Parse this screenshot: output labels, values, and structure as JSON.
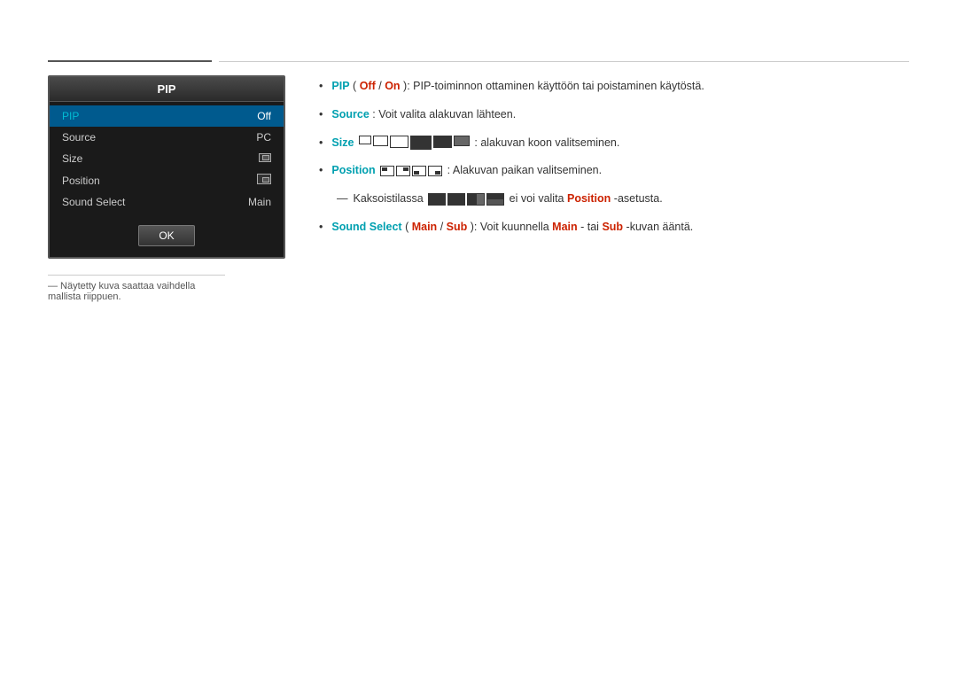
{
  "topLine": {},
  "pipPanel": {
    "title": "PIP",
    "rows": [
      {
        "label": "PIP",
        "value": "Off",
        "selected": true,
        "iconType": "none"
      },
      {
        "label": "Source",
        "value": "PC",
        "selected": false,
        "iconType": "none"
      },
      {
        "label": "Size",
        "value": "",
        "selected": false,
        "iconType": "size"
      },
      {
        "label": "Position",
        "value": "",
        "selected": false,
        "iconType": "position"
      },
      {
        "label": "Sound Select",
        "value": "Main",
        "selected": false,
        "iconType": "none"
      }
    ],
    "okButton": "OK"
  },
  "footnote": "― Näytetty kuva saattaa vaihdella mallista riippuen.",
  "bullets": [
    {
      "id": "pip",
      "parts": [
        {
          "text": "PIP",
          "style": "cyan-bold"
        },
        {
          "text": " (",
          "style": "normal"
        },
        {
          "text": "Off",
          "style": "red-bold"
        },
        {
          "text": " / ",
          "style": "normal"
        },
        {
          "text": "On",
          "style": "red-bold"
        },
        {
          "text": "): PIP-toiminnon ottaminen käyttöön tai poistaminen käytöstä.",
          "style": "normal"
        }
      ]
    },
    {
      "id": "source",
      "parts": [
        {
          "text": "Source",
          "style": "cyan-bold"
        },
        {
          "text": ": Voit valita alakuvan lähteen.",
          "style": "normal"
        }
      ]
    },
    {
      "id": "size",
      "parts": [
        {
          "text": "Size",
          "style": "cyan-bold"
        },
        {
          "text": " ",
          "style": "normal"
        },
        {
          "text": "ICONS",
          "style": "size-icons"
        },
        {
          "text": ": alakuvan koon valitseminen.",
          "style": "normal"
        }
      ]
    },
    {
      "id": "position",
      "parts": [
        {
          "text": "Position",
          "style": "cyan-bold"
        },
        {
          "text": " ",
          "style": "normal"
        },
        {
          "text": "POS_ICONS",
          "style": "pos-icons"
        },
        {
          "text": ": Alakuvan paikan valitseminen.",
          "style": "normal"
        }
      ]
    }
  ],
  "subLine": {
    "prefix": "― Kaksoistilassa ",
    "iconsType": "dual",
    "suffix": " ei voi valita ",
    "boldWord": "Position",
    "suffix2": "-asetusta."
  },
  "soundSelectBullet": {
    "parts": [
      {
        "text": "Sound Select",
        "style": "cyan-bold"
      },
      {
        "text": " (",
        "style": "normal"
      },
      {
        "text": "Main",
        "style": "red-bold"
      },
      {
        "text": " / ",
        "style": "normal"
      },
      {
        "text": "Sub",
        "style": "red-bold"
      },
      {
        "text": "): Voit kuunnella ",
        "style": "normal"
      },
      {
        "text": "Main",
        "style": "red-bold"
      },
      {
        "text": "- tai ",
        "style": "normal"
      },
      {
        "text": "Sub",
        "style": "red-bold"
      },
      {
        "text": "-kuvan ääntä.",
        "style": "normal"
      }
    ]
  }
}
